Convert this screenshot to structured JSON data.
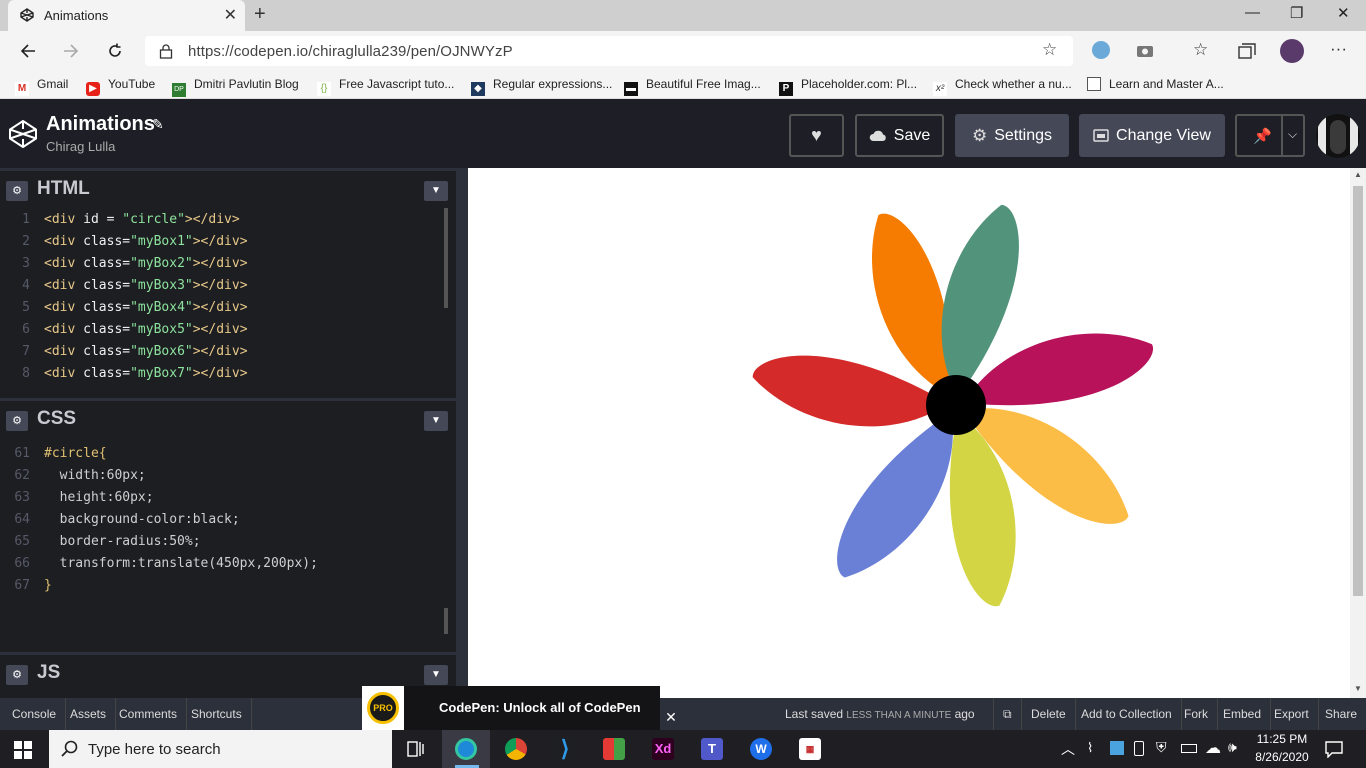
{
  "browser": {
    "tab_title": "Animations",
    "tab_close": "✕",
    "new_tab": "+",
    "url": "https://codepen.io/chiraglulla239/pen/OJNWYzP",
    "window_controls": {
      "minimize": "—",
      "restore": "❐",
      "close": "✕"
    },
    "bookmarks": [
      {
        "label": "Gmail",
        "icon": "gmail-icon"
      },
      {
        "label": "YouTube",
        "icon": "youtube-icon"
      },
      {
        "label": "Dmitri Pavlutin Blog",
        "icon": "dp-icon"
      },
      {
        "label": "Free Javascript tuto...",
        "icon": "js-tutorial-icon"
      },
      {
        "label": "Regular expressions...",
        "icon": "regex-icon"
      },
      {
        "label": "Beautiful Free Imag...",
        "icon": "unsplash-icon"
      },
      {
        "label": "Placeholder.com: Pl...",
        "icon": "placeholder-icon"
      },
      {
        "label": "Check whether a nu...",
        "icon": "math-icon"
      },
      {
        "label": "Learn and Master A...",
        "icon": "document-icon"
      }
    ]
  },
  "codepen": {
    "pen_title": "Animations",
    "author": "Chirag Lulla",
    "buttons": {
      "save": "Save",
      "settings": "Settings",
      "change_view": "Change View"
    },
    "panels": {
      "html": "HTML",
      "css": "CSS",
      "js": "JS"
    },
    "html_lines": [
      {
        "n": "1",
        "attr": "id",
        "sep": " = ",
        "val": "\"circle\""
      },
      {
        "n": "2",
        "attr": "class",
        "sep": "=",
        "val": "\"myBox1\""
      },
      {
        "n": "3",
        "attr": "class",
        "sep": "=",
        "val": "\"myBox2\""
      },
      {
        "n": "4",
        "attr": "class",
        "sep": "=",
        "val": "\"myBox3\""
      },
      {
        "n": "5",
        "attr": "class",
        "sep": "=",
        "val": "\"myBox4\""
      },
      {
        "n": "6",
        "attr": "class",
        "sep": "=",
        "val": "\"myBox5\""
      },
      {
        "n": "7",
        "attr": "class",
        "sep": "=",
        "val": "\"myBox6\""
      },
      {
        "n": "8",
        "attr": "class",
        "sep": "=",
        "val": "\"myBox7\""
      }
    ],
    "css_lines": [
      {
        "n": "61",
        "text": "#circle{"
      },
      {
        "n": "62",
        "text": "  width:60px;"
      },
      {
        "n": "63",
        "text": "  height:60px;"
      },
      {
        "n": "64",
        "text": "  background-color:black;"
      },
      {
        "n": "65",
        "text": "  border-radius:50%;"
      },
      {
        "n": "66",
        "text": "  transform:translate(450px,200px);"
      },
      {
        "n": "67",
        "text": "}"
      }
    ],
    "footer": {
      "console": "Console",
      "assets": "Assets",
      "comments": "Comments",
      "shortcuts": "Shortcuts",
      "promo_badge": "PRO",
      "promo_text": "CodePen: Unlock all of CodePen",
      "promo_close": "✕",
      "last_saved_label": "Last saved",
      "last_saved_value": "LESS THAN A MINUTE",
      "last_saved_suffix": "ago",
      "delete": "Delete",
      "add_to_collection": "Add to Collection",
      "fork": "Fork",
      "embed": "Embed",
      "export": "Export",
      "share": "Share"
    },
    "petal_colors": [
      "#f57c00",
      "#52937c",
      "#d42a2a",
      "#b8125b",
      "#6a7fd6",
      "#fbbd45",
      "#d3d544"
    ],
    "center_color": "#000000"
  },
  "taskbar": {
    "search_placeholder": "Type here to search",
    "time": "11:25 PM",
    "date": "8/26/2020"
  }
}
